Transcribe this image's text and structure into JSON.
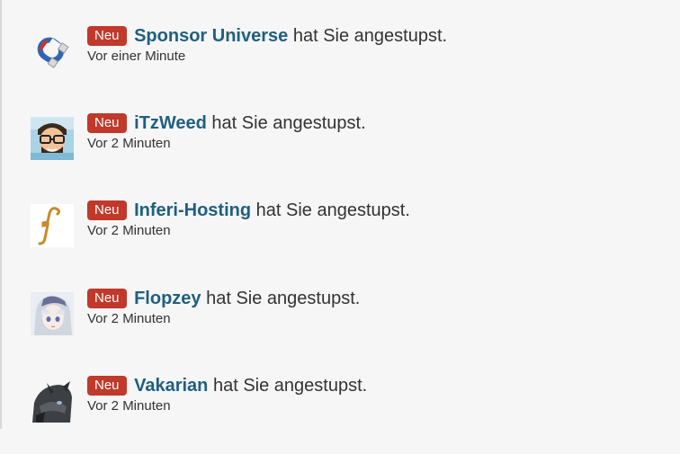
{
  "notifications": [
    {
      "badge": "Neu",
      "user": "Sponsor Universe",
      "action": "hat Sie angestupst.",
      "time": "Vor einer Minute",
      "avatar_icon": "sponsor-universe-avatar"
    },
    {
      "badge": "Neu",
      "user": "iTzWeed",
      "action": "hat Sie angestupst.",
      "time": "Vor 2 Minuten",
      "avatar_icon": "itzweed-avatar"
    },
    {
      "badge": "Neu",
      "user": "Inferi-Hosting",
      "action": "hat Sie angestupst.",
      "time": "Vor 2 Minuten",
      "avatar_icon": "inferi-hosting-avatar"
    },
    {
      "badge": "Neu",
      "user": "Flopzey",
      "action": "hat Sie angestupst.",
      "time": "Vor 2 Minuten",
      "avatar_icon": "flopzey-avatar"
    },
    {
      "badge": "Neu",
      "user": "Vakarian",
      "action": "hat Sie angestupst.",
      "time": "Vor 2 Minuten",
      "avatar_icon": "vakarian-avatar"
    }
  ],
  "colors": {
    "badge": "#c0392b",
    "username": "#1f5f80",
    "background": "#f6f6f6"
  }
}
